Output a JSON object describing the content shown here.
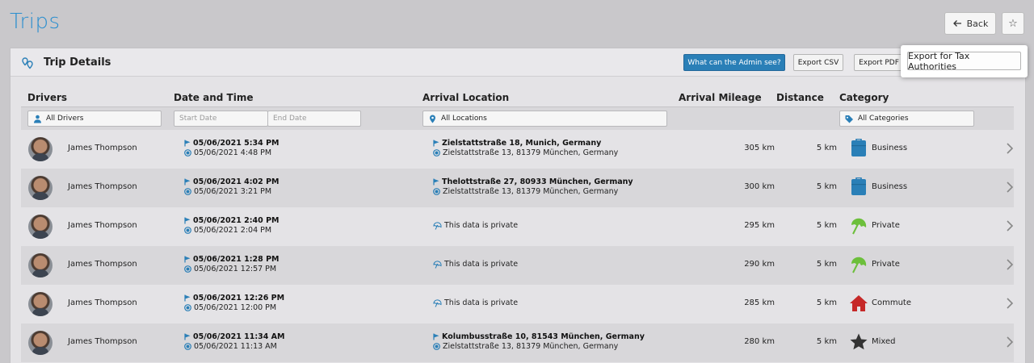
{
  "page": {
    "title": "Trips"
  },
  "header": {
    "back_label": "Back",
    "star_icon": "star-icon"
  },
  "panel": {
    "title": "Trip Details",
    "admin_button": "What can the Admin see?",
    "export_csv": "Export CSV",
    "export_pdf": "Export PDF",
    "export_tax": "Export for Tax Authorities"
  },
  "columns": {
    "drivers": "Drivers",
    "date_time": "Date and Time",
    "arrival_location": "Arrival Location",
    "arrival_mileage": "Arrival Mileage",
    "distance": "Distance",
    "category": "Category"
  },
  "filters": {
    "drivers": "All Drivers",
    "start_date": "Start Date",
    "end_date": "End Date",
    "locations": "All Locations",
    "categories": "All Categories"
  },
  "trips": [
    {
      "driver": "James Thompson",
      "end_time": "05/06/2021 5:34 PM",
      "start_time": "05/06/2021 4:48 PM",
      "arrival": "Zielstattstraße 18, Munich, Germany",
      "departure": "Zielstattstraße 13, 81379 München, Germany",
      "private_text": "",
      "mileage": "305 km",
      "distance": "5 km",
      "category": "Business",
      "category_icon": "briefcase-icon",
      "category_color": "#2a7fb7"
    },
    {
      "driver": "James Thompson",
      "end_time": "05/06/2021 4:02 PM",
      "start_time": "05/06/2021 3:21 PM",
      "arrival": "Thelottstraße 27, 80933 München, Germany",
      "departure": "Zielstattstraße 13, 81379 München, Germany",
      "private_text": "",
      "mileage": "300 km",
      "distance": "5 km",
      "category": "Business",
      "category_icon": "briefcase-icon",
      "category_color": "#2a7fb7"
    },
    {
      "driver": "James Thompson",
      "end_time": "05/06/2021 2:40 PM",
      "start_time": "05/06/2021 2:04 PM",
      "arrival": "",
      "departure": "",
      "private_text": "This data is private",
      "mileage": "295 km",
      "distance": "5 km",
      "category": "Private",
      "category_icon": "umbrella-icon",
      "category_color": "#6cbf3b"
    },
    {
      "driver": "James Thompson",
      "end_time": "05/06/2021 1:28 PM",
      "start_time": "05/06/2021 12:57 PM",
      "arrival": "",
      "departure": "",
      "private_text": "This data is private",
      "mileage": "290 km",
      "distance": "5 km",
      "category": "Private",
      "category_icon": "umbrella-icon",
      "category_color": "#6cbf3b"
    },
    {
      "driver": "James Thompson",
      "end_time": "05/06/2021 12:26 PM",
      "start_time": "05/06/2021 12:00 PM",
      "arrival": "",
      "departure": "",
      "private_text": "This data is private",
      "mileage": "285 km",
      "distance": "5 km",
      "category": "Commute",
      "category_icon": "house-icon",
      "category_color": "#c62828"
    },
    {
      "driver": "James Thompson",
      "end_time": "05/06/2021 11:34 AM",
      "start_time": "05/06/2021 11:13 AM",
      "arrival": "Kolumbusstraße 10, 81543 München, Germany",
      "departure": "Zielstattstraße 13, 81379 München, Germany",
      "private_text": "",
      "mileage": "280 km",
      "distance": "5 km",
      "category": "Mixed",
      "category_icon": "star-icon",
      "category_color": "#333333"
    }
  ]
}
